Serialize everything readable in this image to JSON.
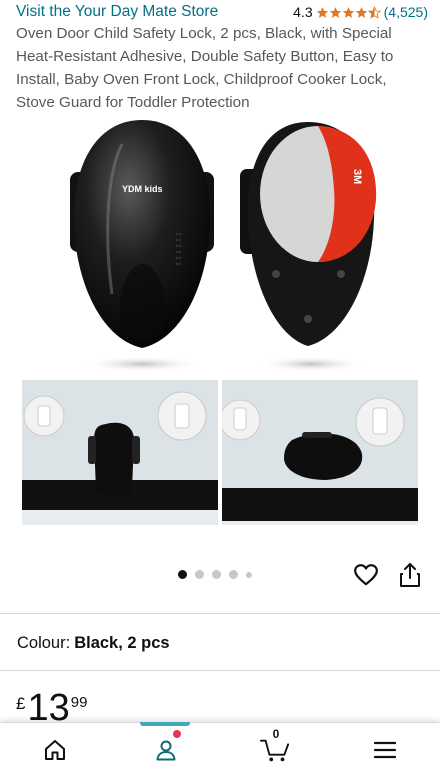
{
  "store": {
    "link_text": "Visit the Your Day Mate Store",
    "rating_value": "4.3",
    "rating_count": "(4,525)",
    "stars": 4.3,
    "star_color": "#DE7921"
  },
  "product": {
    "title": "Oven Door Child Safety Lock, 2 pcs, Black, with Special Heat-Resistant Adhesive, Double Safety Button, Easy to Install, Baby Oven Front Lock, Childproof Cooker Lock, Stove Guard for Toddler Protection",
    "logo_text": "YDM kids",
    "adhesive_brand": "3M"
  },
  "gallery": {
    "image_count": 5,
    "active_index": 0
  },
  "actions": {
    "wishlist_icon": "heart-outline-icon",
    "share_icon": "share-icon"
  },
  "variant": {
    "label": "Colour:",
    "value": "Black, 2 pcs"
  },
  "price": {
    "currency": "£",
    "whole": "13",
    "fraction": "99"
  },
  "bottom_nav": {
    "items": [
      {
        "name": "home",
        "icon": "home-icon"
      },
      {
        "name": "account",
        "icon": "person-icon",
        "active": true
      },
      {
        "name": "cart",
        "icon": "cart-icon",
        "count": "0"
      },
      {
        "name": "menu",
        "icon": "hamburger-menu-icon"
      }
    ],
    "accent_color": "#3FA9B5",
    "notification_color": "#E8344E"
  }
}
